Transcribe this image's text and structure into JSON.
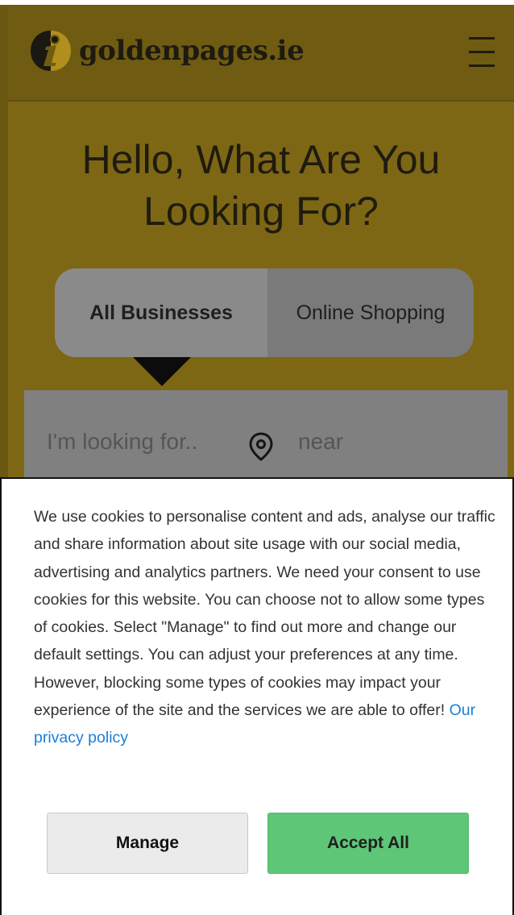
{
  "colors": {
    "header_bg": "#6f5b12",
    "hero_bg": "#7d6715",
    "accept_button": "#5dc677",
    "link": "#1a7fd6"
  },
  "header": {
    "logo_text": "goldenpages.ie",
    "logo_icon": "info-i-logo-icon",
    "menu_icon": "hamburger-menu-icon"
  },
  "hero": {
    "title": "Hello, What Are You Looking For?"
  },
  "tabs": [
    {
      "label": "All Businesses",
      "active": true
    },
    {
      "label": "Online Shopping",
      "active": false
    }
  ],
  "search": {
    "what_placeholder": "I'm looking for..",
    "location_icon": "location-pin-icon",
    "where_placeholder": "near"
  },
  "cookie_banner": {
    "message": "We use cookies to personalise content and ads, analyse our traffic and share information about site usage with our social media, advertising and analytics partners. We need your consent to use cookies for this website. You can choose not to allow some types of cookies. Select \"Manage\" to find out more and change our default settings. You can adjust your preferences at any time. However, blocking some types of cookies may impact your experience of the site and the services we are able to offer!",
    "privacy_link": "Our privacy policy",
    "manage_label": "Manage",
    "accept_label": "Accept All"
  }
}
